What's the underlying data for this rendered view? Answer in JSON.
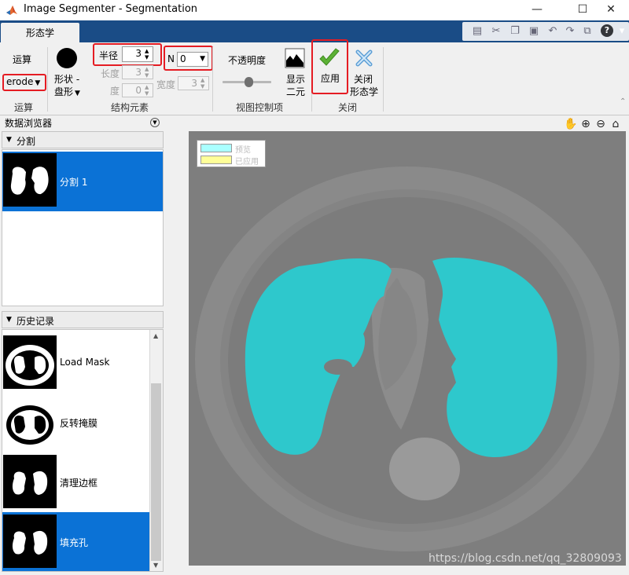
{
  "window": {
    "title": "Image Segmenter - Segmentation",
    "minimize": "—",
    "maximize": "☐",
    "close": "✕"
  },
  "tabs": [
    {
      "label": "形态学",
      "active": true
    }
  ],
  "ribbon": {
    "operation": {
      "title": "运算",
      "dropdown_value": "erode",
      "section_label": "运算"
    },
    "structuring_element": {
      "shape_label_line1": "形状 -",
      "shape_label_line2": "盘形",
      "radius_label": "半径",
      "radius_value": "3",
      "n_label": "N",
      "n_value": "0",
      "length_label": "长度",
      "length_value": "3",
      "width_label": "宽度",
      "width_value": "3",
      "degree_label": "度",
      "degree_value": "0",
      "section_label": "结构元素"
    },
    "view_controls": {
      "opacity_label": "不透明度",
      "opacity_level": 0.55,
      "show_binary_line1": "显示",
      "show_binary_line2": "二元",
      "section_label": "视图控制项"
    },
    "close_group": {
      "apply_label": "应用",
      "close_label_line1": "关闭",
      "close_label_line2": "形态学",
      "section_label": "关闭"
    }
  },
  "data_browser": {
    "title": "数据浏览器",
    "segmentation_header": "分割",
    "segmentations": [
      {
        "label": "分割 1",
        "selected": true
      }
    ],
    "history_header": "历史记录",
    "history": [
      {
        "label": "Load Mask",
        "selected": false
      },
      {
        "label": "反转掩膜",
        "selected": false
      },
      {
        "label": "清理边框",
        "selected": false
      },
      {
        "label": "填充孔",
        "selected": true
      }
    ]
  },
  "legend": {
    "preview": "预览",
    "applied": "已应用"
  },
  "colors": {
    "accent": "#0b72d6",
    "tab_bar": "#1a4c86",
    "highlight_box": "#e51c23",
    "preview_mask": "#2ec8cc",
    "legend_preview": "#aaffff",
    "legend_applied": "#ffff99"
  },
  "watermark": "https://blog.csdn.net/qq_32809093"
}
